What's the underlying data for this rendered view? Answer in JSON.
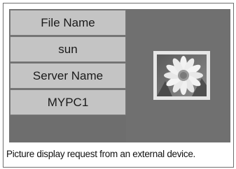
{
  "file_name_label": "File Name",
  "file_name_value": "sun",
  "server_name_label": "Server Name",
  "server_name_value": "MYPC1",
  "thumbnail_icon": "flower-picture-icon",
  "caption": "Picture display request from an external device.",
  "colors": {
    "panel_bg": "#707070",
    "cell_bg": "#c4c4c4",
    "thumb_border": "#e6e6e6"
  }
}
